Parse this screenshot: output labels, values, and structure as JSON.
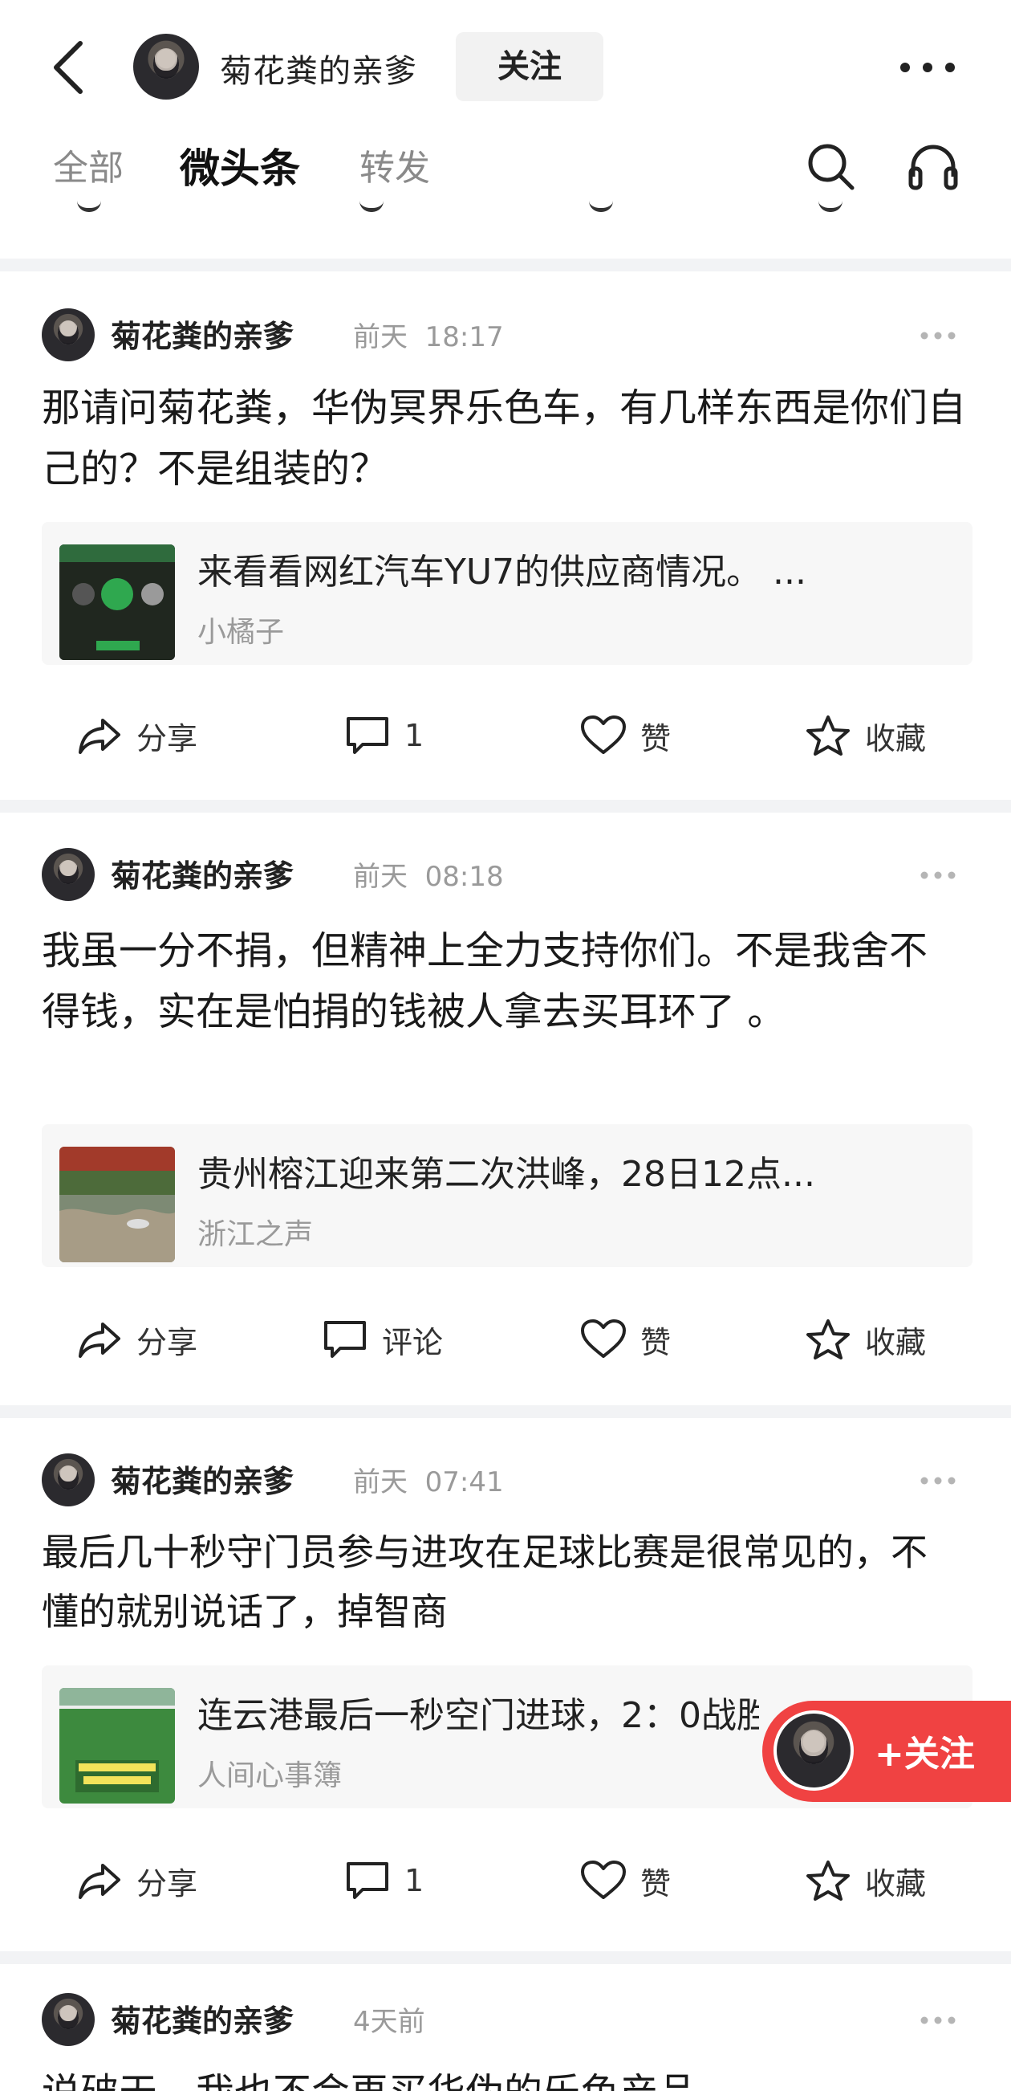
{
  "header": {
    "back_icon": "chevron-left-icon",
    "author_name": "菊花粪的亲爹",
    "follow_label": "关注",
    "more_icon": "ellipsis-icon"
  },
  "tabs": [
    {
      "label": "全部",
      "active": false
    },
    {
      "label": "微头条",
      "active": true
    },
    {
      "label": "转发",
      "active": false
    }
  ],
  "toolbar_icons": [
    "search-icon",
    "headset-icon"
  ],
  "posts": [
    {
      "author": "菊花粪的亲爹",
      "day": "前天",
      "time": "18:17",
      "text": "那请问菊花粪，华伪冥界乐色车，有几样东西是你们自己的？不是组装的？",
      "card": {
        "title": "来看看网红汽车YU7的供应商情况。 ...",
        "source": "小橘子"
      },
      "actions": {
        "share": "分享",
        "comment": "1",
        "like": "赞",
        "favorite": "收藏"
      }
    },
    {
      "author": "菊花粪的亲爹",
      "day": "前天",
      "time": "08:18",
      "text": "我虽一分不捐，但精神上全力支持你们。不是我舍不得钱，实在是怕捐的钱被人拿去买耳环了 。",
      "card": {
        "title": "贵州榕江迎来第二次洪峰，28日12点...",
        "source": "浙江之声"
      },
      "actions": {
        "share": "分享",
        "comment": "评论",
        "like": "赞",
        "favorite": "收藏"
      }
    },
    {
      "author": "菊花粪的亲爹",
      "day": "前天",
      "time": "07:41",
      "text": "最后几十秒守门员参与进攻在足球比赛是很常见的，不懂的就别说话了，掉智商",
      "card": {
        "title": "连云港最后一秒空门进球，2：0战胜",
        "source": "人间心事簿"
      },
      "actions": {
        "share": "分享",
        "comment": "1",
        "like": "赞",
        "favorite": "收藏"
      }
    },
    {
      "author": "菊花粪的亲爹",
      "day": "4天前",
      "time": "",
      "text": "说破天，我也不会再买华伪的乐色产品"
    }
  ],
  "floating_follow": {
    "label": "+关注"
  },
  "colors": {
    "accent": "#f04242",
    "muted": "#9a9a9a",
    "separator": "#f2f3f5"
  }
}
